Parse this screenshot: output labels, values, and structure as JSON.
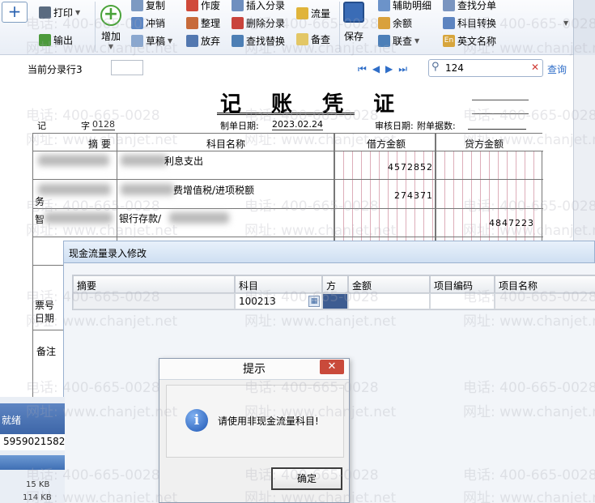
{
  "toolbar": {
    "col1": [
      "打印",
      "输出"
    ],
    "add": "增加",
    "col3": [
      "复制",
      "冲销",
      "草稿"
    ],
    "col4": [
      "作废",
      "整理",
      "放弃"
    ],
    "col5": [
      "插入分录",
      "删除分录",
      "查找替换"
    ],
    "col6": [
      "流量",
      "备查"
    ],
    "save": "保存",
    "col8": [
      "辅助明细",
      "余额",
      "联查"
    ],
    "col9": [
      "查找分单",
      "科目转换",
      "英文名称"
    ]
  },
  "nav": {
    "current_row_label": "当前分录行3",
    "search_value": "124",
    "query_label": "查询"
  },
  "voucher": {
    "title": "记 账 凭 证",
    "type_label": "记",
    "zi_label": "字",
    "number": "0128",
    "date_label": "制单日期:",
    "date": "2023.02.24",
    "audit_label": "审核日期:",
    "attach_label": "附单据数:",
    "headers": {
      "summary": "摘 要",
      "account": "科目名称",
      "debit": "借方金额",
      "credit": "贷方金额"
    },
    "rows": [
      {
        "account_tail": "利息支出",
        "debit": "4572852",
        "credit": ""
      },
      {
        "summary_tail": "务",
        "account_tail": "费增值税/进项税额",
        "debit": "274371",
        "credit": ""
      },
      {
        "summary_tail": "智",
        "account_tail": "银行存款/",
        "debit": "",
        "credit": "4847223"
      }
    ],
    "ticket_label": "票号",
    "date_row_label": "日期",
    "note_label": "备注"
  },
  "cashflow_dialog": {
    "title": "现金流量录入修改",
    "columns": [
      "摘要",
      "科目",
      "方向",
      "金额",
      "项目编码",
      "项目名称"
    ],
    "row": {
      "account": "100213"
    }
  },
  "message_box": {
    "title": "提示",
    "message": "请使用非现金流量科目!",
    "ok": "确定",
    "close": "✕"
  },
  "left_panel": {
    "status": "就绪",
    "number": "5959021582",
    "size1": "15 KB",
    "size2": "114 KB"
  },
  "watermark": {
    "phone": "电话: 400-665-0028",
    "site": "网址: www.chanjet.net"
  }
}
